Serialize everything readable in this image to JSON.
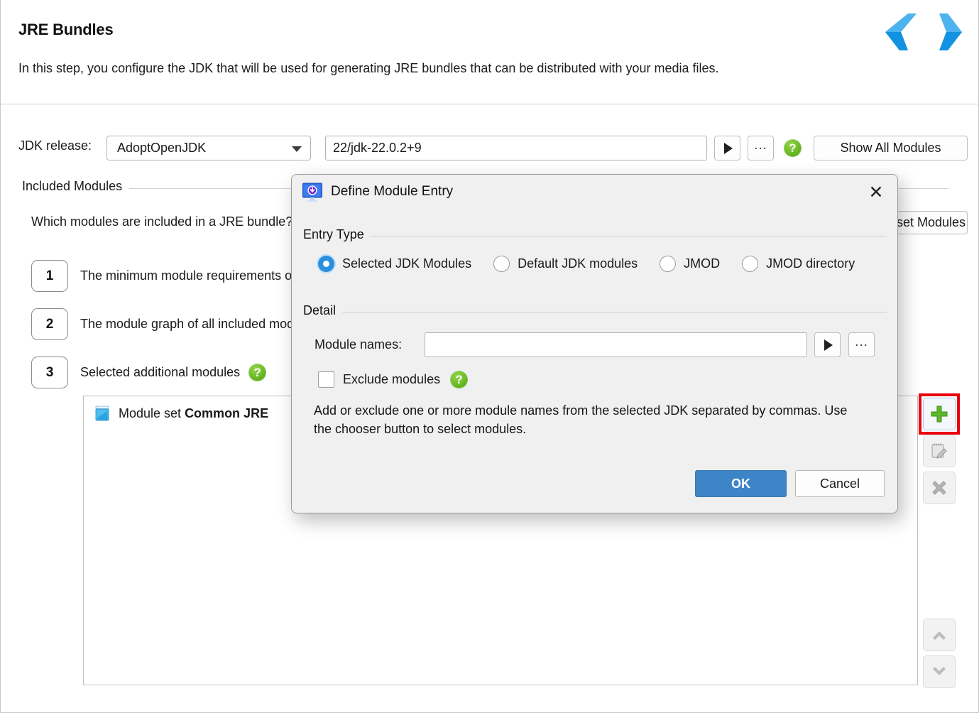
{
  "header": {
    "title": "JRE Bundles",
    "subtitle": "In this step, you configure the JDK that will be used for generating JRE bundles that can be distributed with your media files.",
    "prev_icon": "chevron-left-icon",
    "next_icon": "chevron-right-icon",
    "arrow_color_light": "#4db3ef",
    "arrow_color_dark": "#1292e0"
  },
  "jdk_row": {
    "label": "JDK release:",
    "release_value": "AdoptOpenJDK",
    "path_value": "22/jdk-22.0.2+9",
    "path_placeholder": "",
    "play_icon": "play-triangle-icon",
    "dots_label": "...",
    "help_icon": "help-icon",
    "help_glyph": "?",
    "show_all_modules_label": "Show All Modules"
  },
  "included_modules": {
    "group_title": "Included Modules",
    "question": "Which modules are included in a JRE bundle?",
    "reset_button_label": "Reset Modules",
    "steps": [
      {
        "number": "1",
        "text": "The minimum module requirements of the application",
        "has_help": false
      },
      {
        "number": "2",
        "text": "The module graph of all included modules",
        "has_help": false
      },
      {
        "number": "3",
        "text": "Selected additional modules",
        "has_help": true
      }
    ],
    "list_row": {
      "icon": "package-icon",
      "prefix": "Module set ",
      "bold": "Common JRE"
    }
  },
  "side_toolbar": {
    "add": {
      "label": "add-entry",
      "icon": "plus-icon",
      "highlighted": true,
      "highlight_color": "#e8000c"
    },
    "edit": {
      "label": "edit-entry",
      "icon": "edit-pencil-icon"
    },
    "remove": {
      "label": "remove-entry",
      "icon": "x-cross-icon"
    },
    "move_up": {
      "label": "move-up",
      "icon": "chevron-up-icon"
    },
    "move_down": {
      "label": "move-down",
      "icon": "chevron-down-icon"
    }
  },
  "dialog": {
    "app_icon": "monitor-download-icon",
    "title": "Define Module Entry",
    "close_glyph": "✕",
    "entry_type": {
      "group_title": "Entry Type",
      "options": [
        {
          "label": "Selected JDK Modules",
          "checked": true
        },
        {
          "label": "Default JDK modules",
          "checked": false
        },
        {
          "label": "JMOD",
          "checked": false
        },
        {
          "label": "JMOD directory",
          "checked": false
        }
      ]
    },
    "detail": {
      "group_title": "Detail",
      "module_names_label": "Module names:",
      "module_names_value": "",
      "module_names_placeholder": "",
      "play_icon": "play-triangle-icon",
      "dots_label": "...",
      "exclude_label": "Exclude modules",
      "exclude_checked": false,
      "exclude_help_glyph": "?"
    },
    "description": "Add or exclude one or more module names from the selected JDK separated by commas. Use the chooser button to select modules.",
    "ok_label": "OK",
    "cancel_label": "Cancel",
    "ok_color": "#3d85c6"
  }
}
